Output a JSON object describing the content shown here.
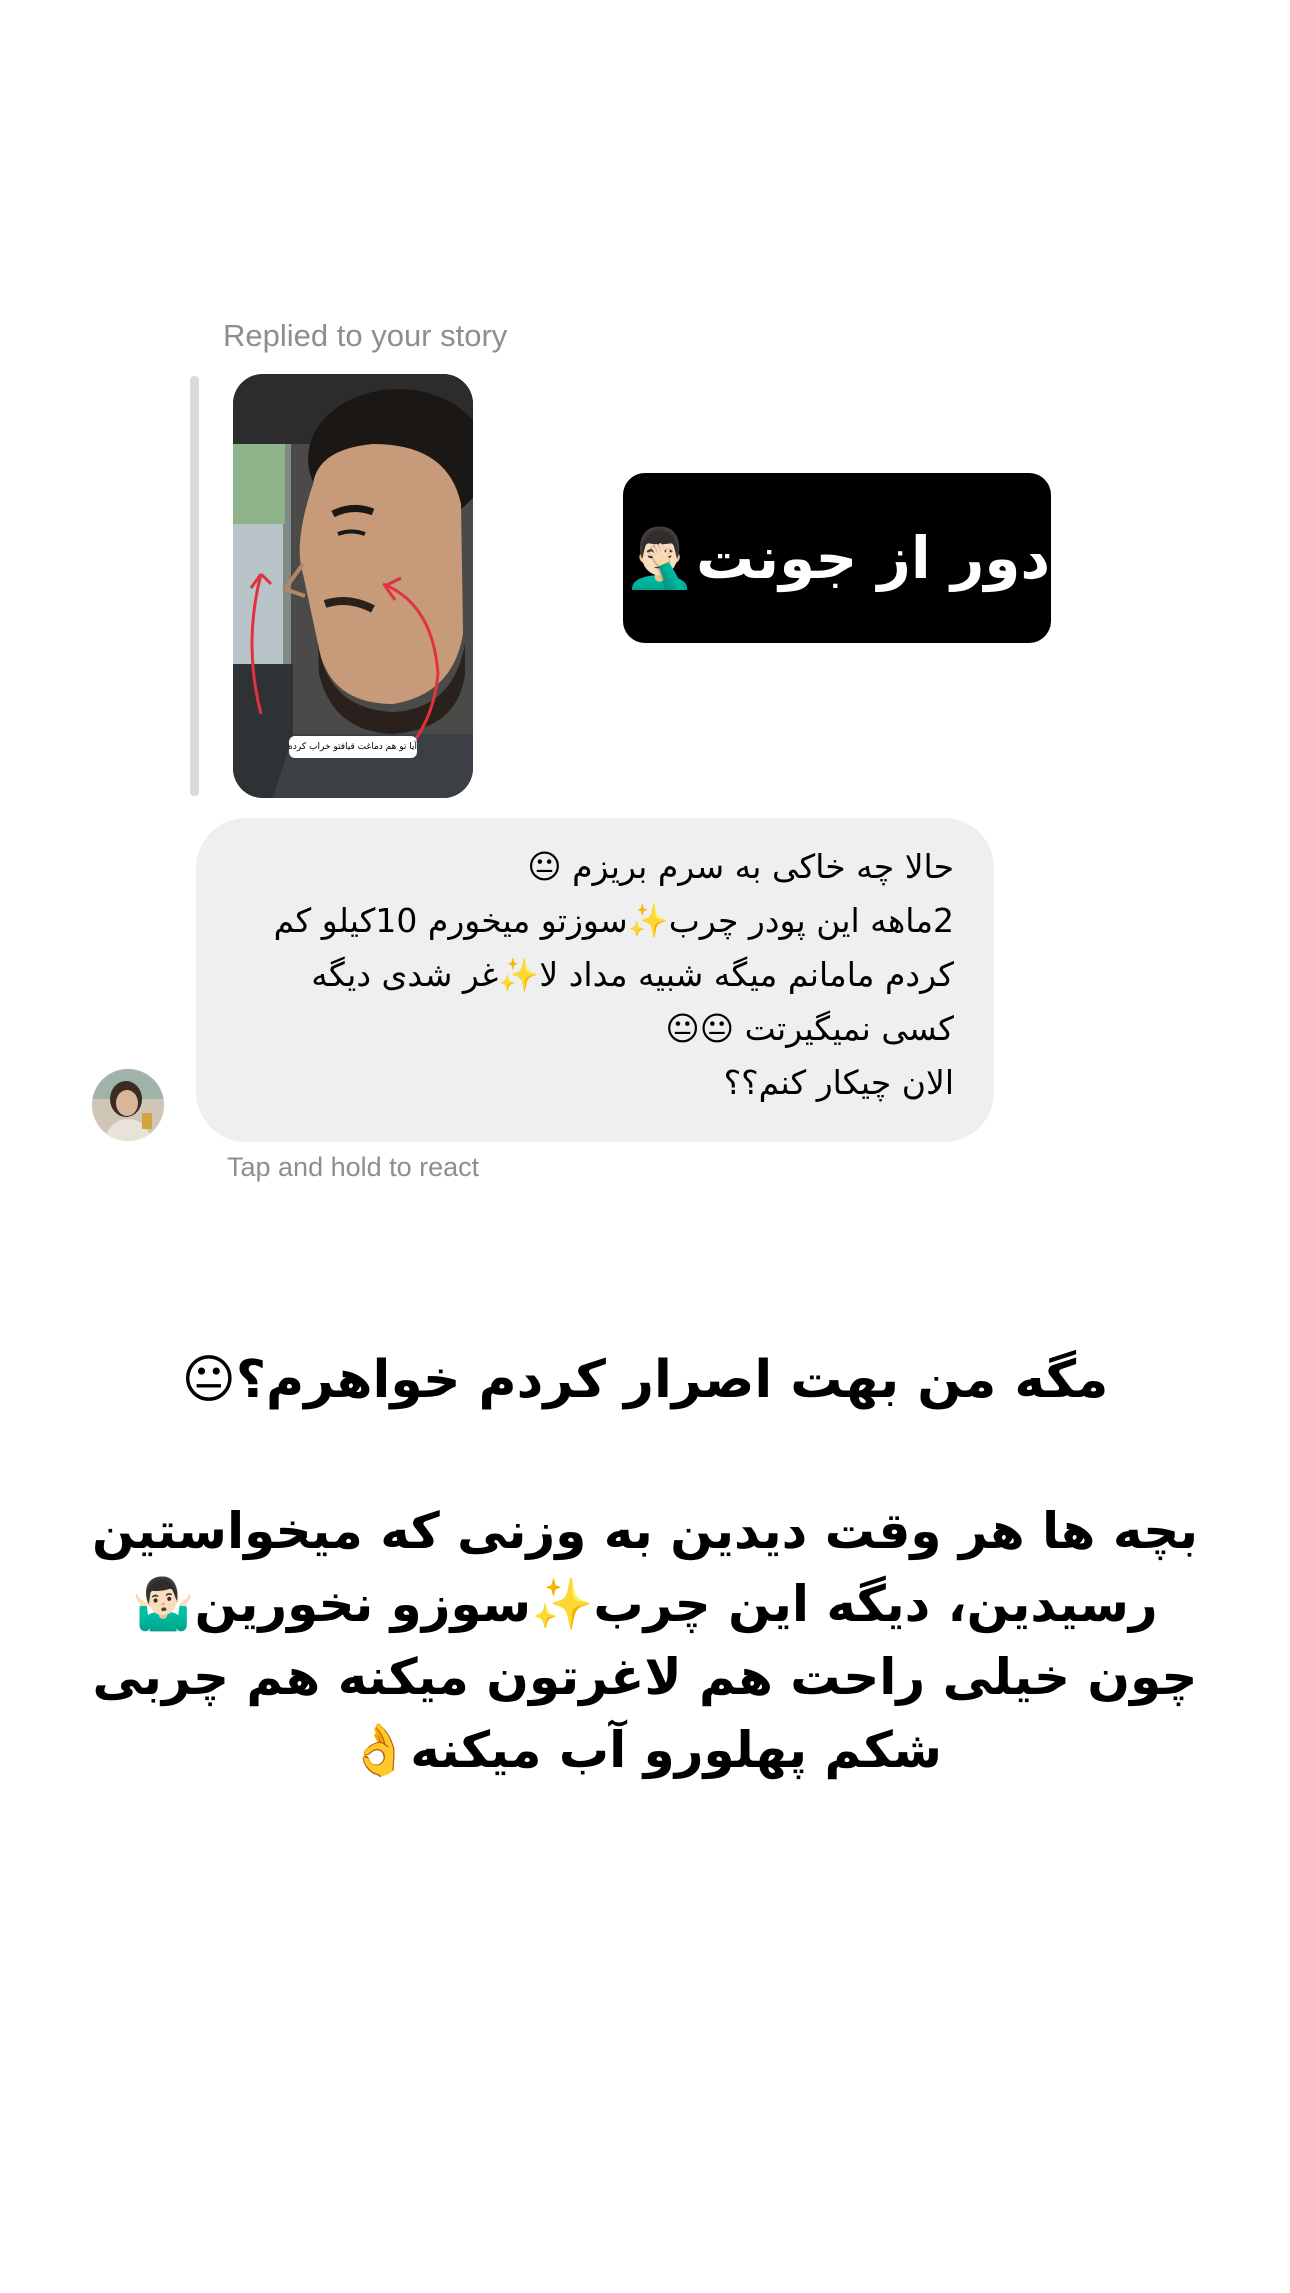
{
  "reply_header": "Replied to your story",
  "story": {
    "sticker_text": "آیا تو هم دماغت قیافتو خراب کرده؟😥"
  },
  "sticker": {
    "text": "دور از جونت🤦🏻‍♂️"
  },
  "message": {
    "lines": [
      "حالا چه خاکی به سرم بریزم 😐",
      "2ماهه این پودر چرب✨سوزتو میخورم 10کیلو کم",
      "کردم مامانم میگه شبیه مداد لا✨غر شدی دیگه",
      "کسی  نمیگیرتت 😐😐",
      "الان چیکار کنم؟؟"
    ]
  },
  "footer_hint": "Tap and hold to react",
  "caption": {
    "question": "مگه من بهت اصرار کردم خواهرم؟😐",
    "body_lines": [
      "بچه ها هر وقت دیدین به وزنی که میخواستین",
      "رسیدین، دیگه این چرب✨سوزو نخورین🤷🏻‍♂️",
      "چون خیلی راحت هم لاغرتون میکنه هم چربی",
      "شکم پهلورو آب میکنه👌"
    ]
  },
  "colors": {
    "background": "#ffffff",
    "secondary_text": "#8e8e8e",
    "bubble": "#efefef",
    "reply_bar": "#dbdbdb",
    "sticker_bg": "#000000"
  }
}
